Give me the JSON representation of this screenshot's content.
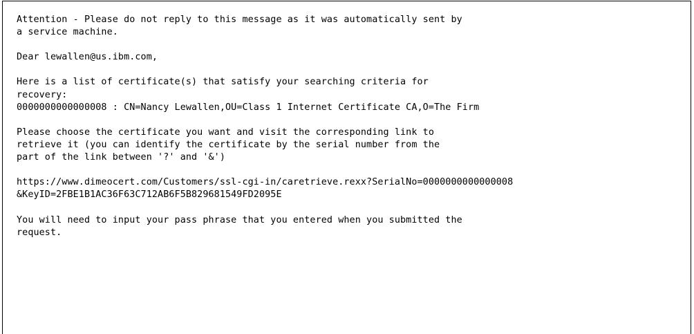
{
  "email": {
    "attention_line_1": "Attention - Please do not reply to this message as it was automatically sent by",
    "attention_line_2": "a service machine.",
    "greeting": "Dear lewallen@us.ibm.com,",
    "intro_line_1": "Here is a list of certificate(s) that satisfy your searching criteria for",
    "intro_line_2": "recovery:",
    "certificate_entry": "0000000000000008 : CN=Nancy Lewallen,OU=Class 1 Internet Certificate CA,O=The Firm",
    "instruction_line_1": "Please choose the certificate you want and visit the corresponding link to",
    "instruction_line_2": "retrieve it (you can identify the certificate by the serial number from the",
    "instruction_line_3": "part of the link between '?' and '&')",
    "link_line_1": "https://www.dimeocert.com/Customers/ssl-cgi-in/caretrieve.rexx?SerialNo=0000000000000008",
    "link_line_2": "&KeyID=2FBE1B1AC36F63C712AB6F5B829681549FD2095E",
    "closing_line_1": "You will need to input your pass phrase that you entered when you submitted the",
    "closing_line_2": "request."
  }
}
